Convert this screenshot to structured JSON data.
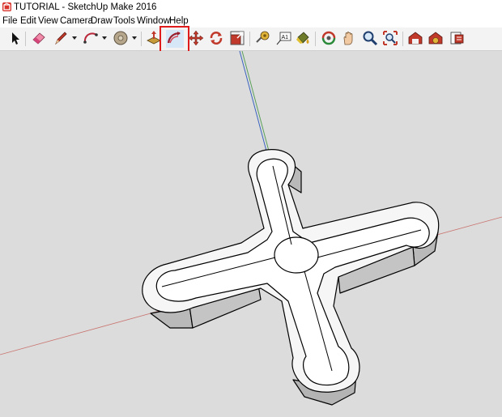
{
  "window": {
    "title": "TUTORIAL - SketchUp Make 2016"
  },
  "menubar": {
    "items": [
      "File",
      "Edit",
      "View",
      "Camera",
      "Draw",
      "Tools",
      "Window",
      "Help"
    ]
  },
  "toolbar": {
    "tools": [
      {
        "icon": "select-arrow-icon"
      },
      {
        "icon": "eraser-icon"
      },
      {
        "icon": "pencil-line-icon",
        "dropdown": true
      },
      {
        "icon": "arc-icon",
        "dropdown": true
      },
      {
        "icon": "circle-icon",
        "dropdown": true
      },
      {
        "icon": "push-pull-icon"
      },
      {
        "icon": "follow-me-icon",
        "highlighted": true
      },
      {
        "icon": "move-icon"
      },
      {
        "icon": "rotate-icon"
      },
      {
        "icon": "scale-icon"
      },
      {
        "icon": "tape-measure-icon"
      },
      {
        "icon": "text-icon",
        "label": "A1"
      },
      {
        "icon": "paint-bucket-icon"
      },
      {
        "icon": "orbit-icon"
      },
      {
        "icon": "pan-hand-icon"
      },
      {
        "icon": "zoom-icon"
      },
      {
        "icon": "zoom-extents-icon"
      },
      {
        "icon": "warehouse-icon"
      },
      {
        "icon": "extension-warehouse-icon"
      },
      {
        "icon": "layout-icon"
      }
    ],
    "highlight_color": "#e01b1b"
  },
  "viewport": {
    "background": "#dcdcdc",
    "axes": {
      "red": "#c0504d",
      "green": "#5aa05a",
      "blue": "#3a63c0"
    },
    "model": "cross-shaped-part"
  }
}
